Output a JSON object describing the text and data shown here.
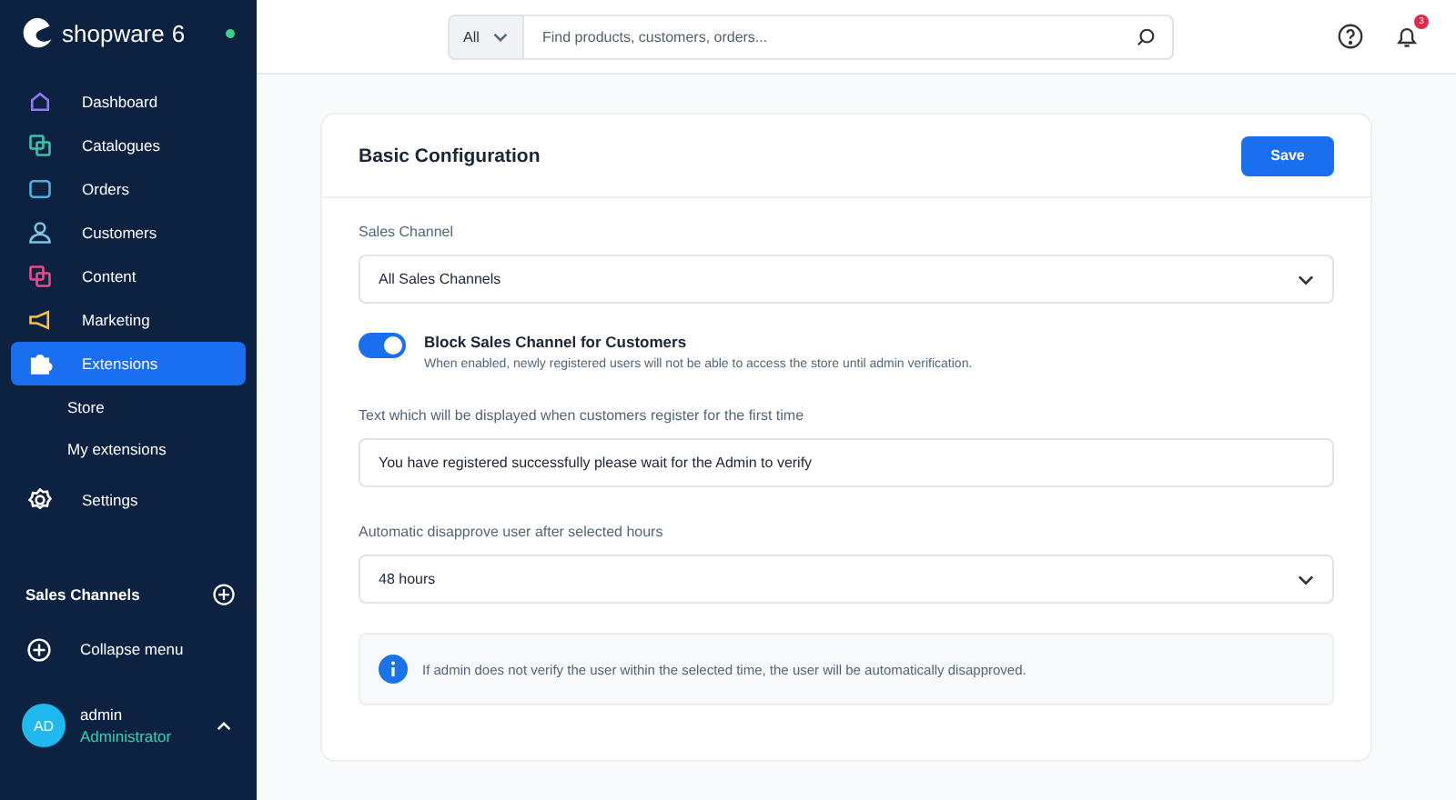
{
  "sidebar": {
    "logo": "shopware",
    "logo_version": "6",
    "online": true,
    "items": [
      {
        "label": "Dashboard",
        "selected": false,
        "color": "#8b7cf6"
      },
      {
        "label": "Catalogues",
        "selected": false,
        "color": "#3cc2a8"
      },
      {
        "label": "Orders",
        "selected": false,
        "color": "#4fb3d9"
      },
      {
        "label": "Customers",
        "selected": false,
        "color": "#7dc4e4"
      },
      {
        "label": "Content",
        "selected": false,
        "color": "#e0508a"
      },
      {
        "label": "Marketing",
        "selected": false,
        "color": "#f5c04a"
      },
      {
        "label": "Extensions",
        "selected": true,
        "color": "#ffffff",
        "children": [
          {
            "label": "Store"
          },
          {
            "label": "My extensions"
          }
        ]
      },
      {
        "label": "Settings",
        "selected": false,
        "color": "#ffffff"
      }
    ],
    "sales_channels": "Sales Channels",
    "collapse": "Collapse menu",
    "user": {
      "initials": "AD",
      "name": "admin",
      "role": "Administrator"
    }
  },
  "topbar": {
    "search_scope": "All",
    "search_placeholder": "Find products, customers, orders...",
    "notifications": "3"
  },
  "card": {
    "title": "Basic Configuration",
    "save": "Save",
    "sales_channel": {
      "label": "Sales Channel",
      "value": "All Sales Channels"
    },
    "toggle": {
      "label": "Block Sales Channel for Customers",
      "help": "When enabled, newly registered users will not be able to access the store until admin verification.",
      "on": true
    },
    "register_text": {
      "label": "Text which will be displayed when customers register for the first time",
      "value": "You have registered successfully please wait for the Admin to verify"
    },
    "hours": {
      "label": "Automatic disapprove user after selected hours",
      "value": "48 hours"
    },
    "info": "If admin does not verify the user within the selected time, the user will be automatically disapproved."
  }
}
